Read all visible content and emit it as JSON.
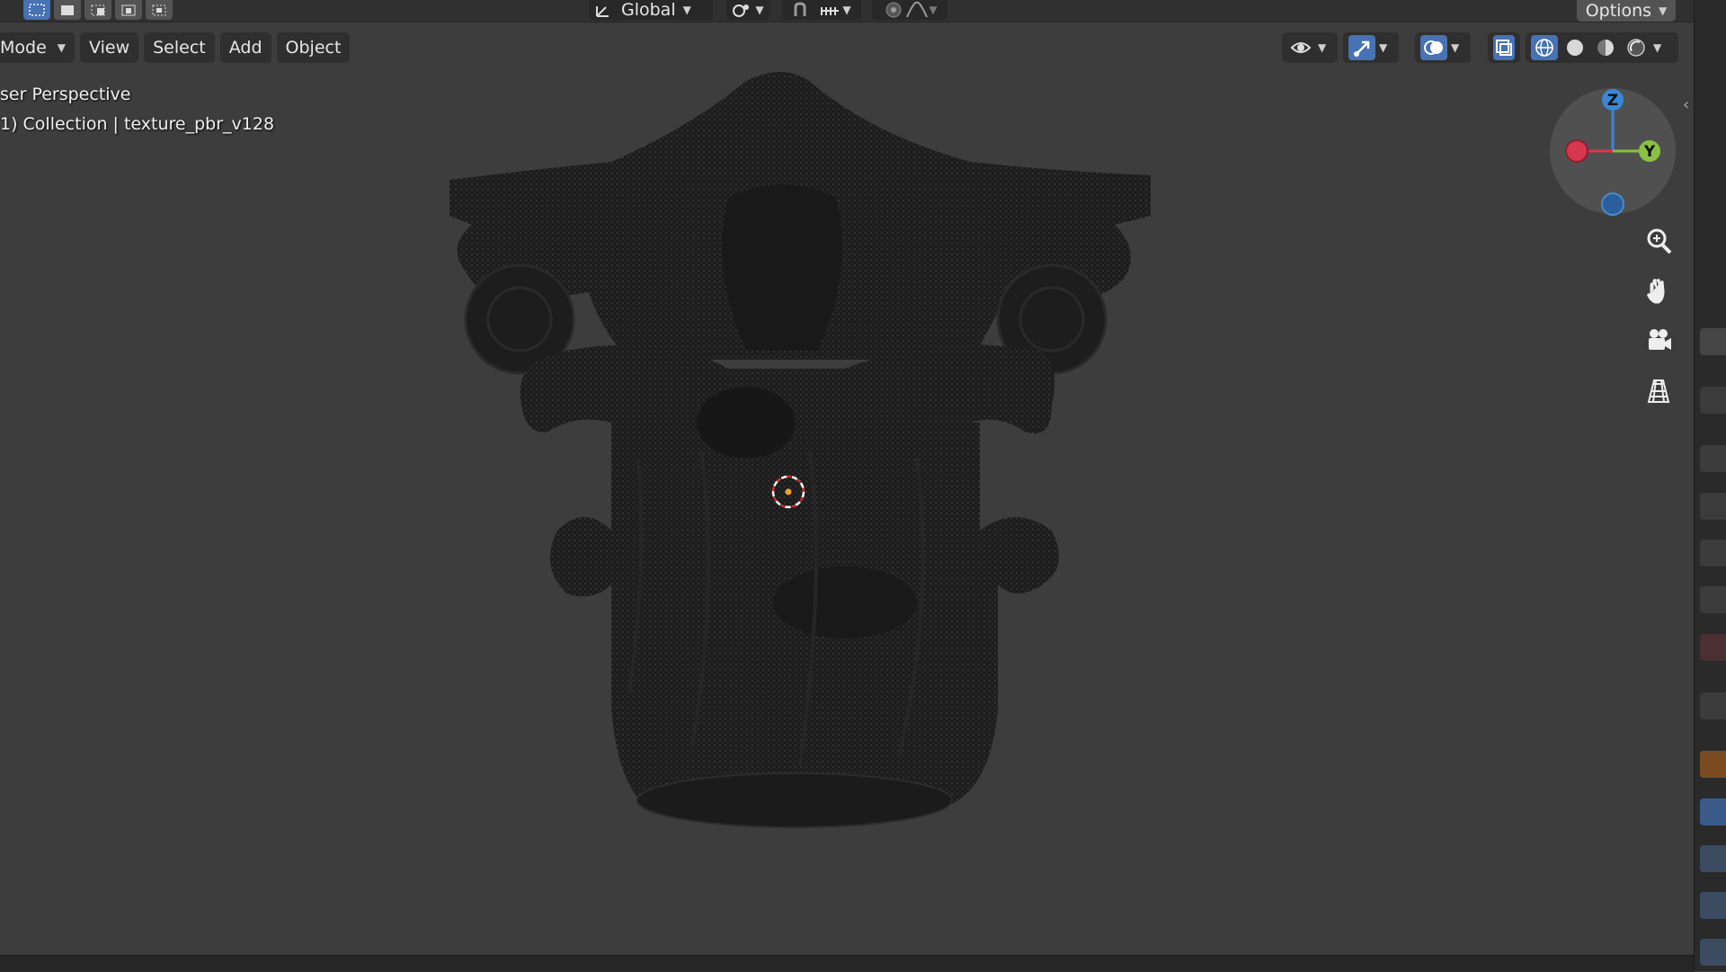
{
  "header": {
    "orientation_label": "Global",
    "options_label": "Options"
  },
  "menu": {
    "mode_label": "Mode",
    "items": [
      "View",
      "Select",
      "Add",
      "Object"
    ]
  },
  "viewport": {
    "view_name": "ser Perspective",
    "collection_info": "1) Collection | texture_pbr_v128"
  },
  "gizmo": {
    "z_label": "Z",
    "y_label": "Y",
    "colors": {
      "x": "#d9374f",
      "y": "#8bc043",
      "z": "#3b86d6"
    }
  },
  "icons": [
    "select-box-icon",
    "transform-pivot-icon",
    "snap-icon",
    "proportional-edit-icon",
    "visibility-icon",
    "gizmo-icon",
    "overlay-icon",
    "xray-icon",
    "wireframe-shading-icon",
    "solid-shading-icon",
    "material-shading-icon",
    "rendered-shading-icon",
    "zoom-icon",
    "hand-pan-icon",
    "camera-icon",
    "grid-ortho-icon",
    "3d-cursor-icon"
  ],
  "colors": {
    "accent": "#4772b3",
    "viewport_bg": "#3d3d3d",
    "header_bg": "#303030"
  }
}
